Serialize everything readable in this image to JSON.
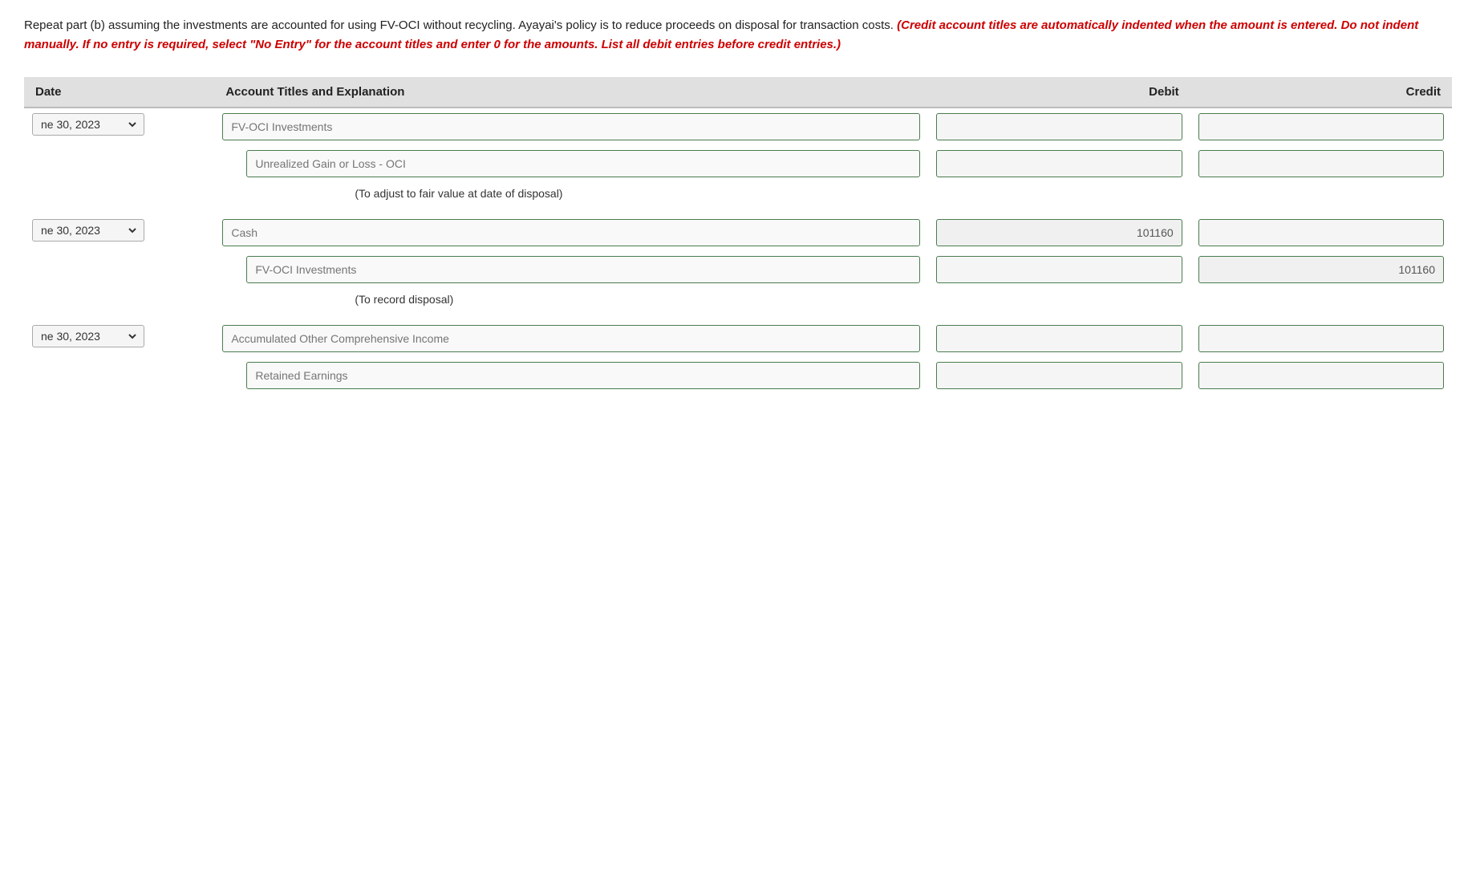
{
  "instructions": {
    "main_text": "Repeat part (b) assuming the investments are accounted for using FV-OCI without recycling. Ayayai's policy is to reduce proceeds on disposal for transaction costs.",
    "red_text": "(Credit account titles are automatically indented when the amount is entered. Do not indent manually. If no entry is required, select \"No Entry\" for the account titles and enter 0 for the amounts. List all debit entries before credit entries.)"
  },
  "table": {
    "headers": {
      "date": "Date",
      "account": "Account Titles and Explanation",
      "debit": "Debit",
      "credit": "Credit"
    },
    "entry_groups": [
      {
        "id": "group1",
        "date": "ne 30, 2023",
        "rows": [
          {
            "account_placeholder": "FV-OCI Investments",
            "account_value": "",
            "debit_value": "",
            "credit_value": "",
            "indented": false
          },
          {
            "account_placeholder": "Unrealized Gain or Loss - OCI",
            "account_value": "",
            "debit_value": "",
            "credit_value": "",
            "indented": true
          }
        ],
        "memo": "(To adjust to fair value at date of disposal)"
      },
      {
        "id": "group2",
        "date": "ne 30, 2023",
        "rows": [
          {
            "account_placeholder": "Cash",
            "account_value": "",
            "debit_value": "101160",
            "credit_value": "",
            "indented": false
          },
          {
            "account_placeholder": "FV-OCI Investments",
            "account_value": "",
            "debit_value": "",
            "credit_value": "101160",
            "indented": true
          }
        ],
        "memo": "(To record disposal)"
      },
      {
        "id": "group3",
        "date": "ne 30, 2023",
        "rows": [
          {
            "account_placeholder": "Accumulated Other Comprehensive Income",
            "account_value": "",
            "debit_value": "",
            "credit_value": "",
            "indented": false
          },
          {
            "account_placeholder": "Retained Earnings",
            "account_value": "",
            "debit_value": "",
            "credit_value": "",
            "indented": true
          }
        ],
        "memo": ""
      }
    ]
  }
}
